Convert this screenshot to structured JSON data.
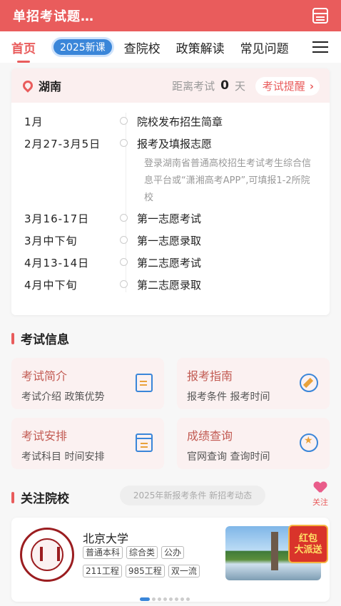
{
  "header": {
    "title": "单招考试题…",
    "calendar_icon": "calendar-icon"
  },
  "tabs": [
    "首页",
    "2025新课",
    "查院校",
    "政策解读",
    "常见问题"
  ],
  "schedule": {
    "region": "湖南",
    "distance_label": "距离考试",
    "days": "0",
    "days_unit": "天",
    "remind_label": "考试提醒",
    "rows": [
      {
        "date": "1月",
        "event": "院校发布招生简章"
      },
      {
        "date": "2月27-3月5日",
        "event": "报考及填报志愿",
        "note": "登录湖南省普通高校招生考试考生综合信息平台或“潇湘高考APP”,可填报1-2所院校"
      },
      {
        "date": "3月16-17日",
        "event": "第一志愿考试"
      },
      {
        "date": "3月中下旬",
        "event": "第一志愿录取"
      },
      {
        "date": "4月13-14日",
        "event": "第二志愿考试"
      },
      {
        "date": "4月中下旬",
        "event": "第二志愿录取"
      }
    ]
  },
  "exam_info": {
    "title": "考试信息",
    "cards": [
      {
        "title": "考试简介",
        "sub": "考试介绍 政策优势",
        "icon": "document-icon"
      },
      {
        "title": "报考指南",
        "sub": "报考条件 报考时间",
        "icon": "compass-icon"
      },
      {
        "title": "考试安排",
        "sub": "考试科目 时间安排",
        "icon": "calendar-icon"
      },
      {
        "title": "成绩查询",
        "sub": "官网查询 查询时间",
        "icon": "medal-icon"
      }
    ]
  },
  "follow": {
    "title": "关注院校",
    "search_placeholder": "2025年新报考条件 新招考动态",
    "follow_label": "关注"
  },
  "university": {
    "name": "北京大学",
    "tags_row1": [
      "普通本科",
      "综合类",
      "公办"
    ],
    "tags_row2": [
      "211工程",
      "985工程",
      "双一流"
    ],
    "redpack_line1": "红包",
    "redpack_line2": "大派送"
  }
}
